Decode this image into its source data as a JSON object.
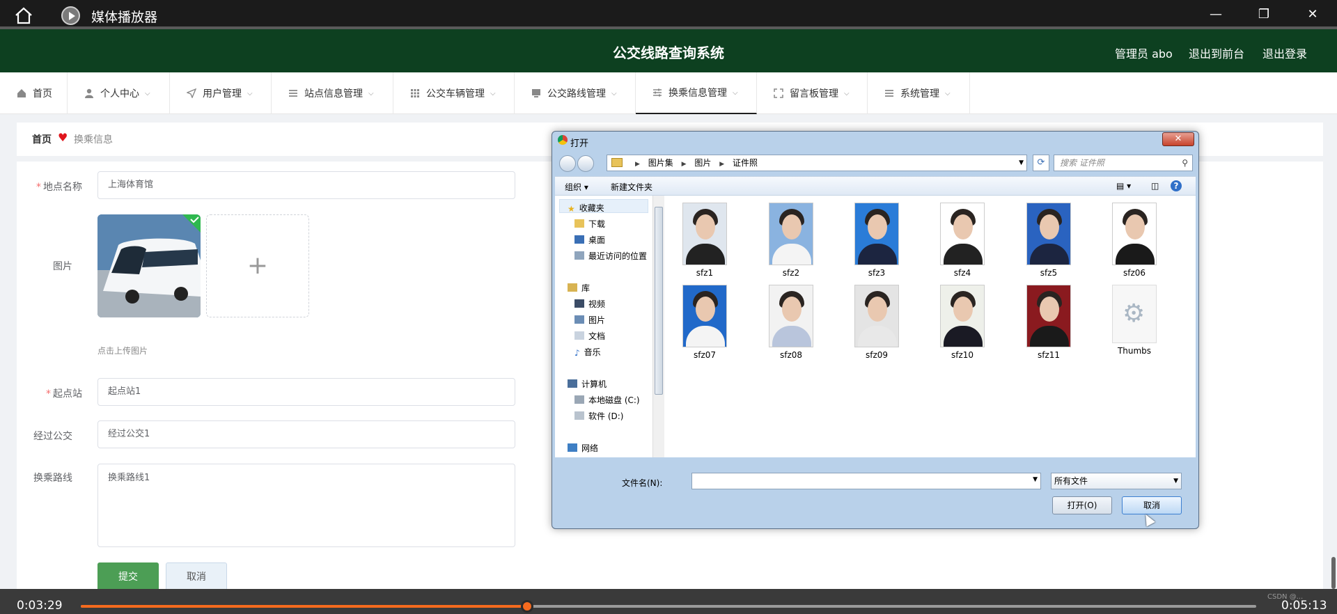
{
  "player": {
    "app_title": "媒体播放器",
    "current_time": "0:03:29",
    "total_time": "0:05:13",
    "progress_fraction": 0.38,
    "watermark": "CSDN @...",
    "accent": "#f56a1e"
  },
  "header": {
    "system_title": "公交线路查询系统",
    "admin_label": "管理员 abo",
    "frontend_link": "退出到前台",
    "logout_link": "退出登录",
    "bg_color": "#0d4020"
  },
  "nav": {
    "items": [
      {
        "label": "首页",
        "icon": "home-icon"
      },
      {
        "label": "个人中心",
        "icon": "user-icon"
      },
      {
        "label": "用户管理",
        "icon": "send-icon"
      },
      {
        "label": "站点信息管理",
        "icon": "list-icon"
      },
      {
        "label": "公交车辆管理",
        "icon": "grid-icon"
      },
      {
        "label": "公交路线管理",
        "icon": "monitor-icon"
      },
      {
        "label": "换乘信息管理",
        "icon": "sliders-icon"
      },
      {
        "label": "留言板管理",
        "icon": "expand-icon"
      },
      {
        "label": "系统管理",
        "icon": "menu-icon"
      }
    ],
    "active_index": 6
  },
  "breadcrumb": {
    "home": "首页",
    "current": "换乘信息"
  },
  "form": {
    "location_label": "地点名称",
    "location_value": "上海体育馆",
    "image_label": "图片",
    "upload_tip": "点击上传图片",
    "start_label": "起点站",
    "start_value": "起点站1",
    "bus_label": "经过公交",
    "bus_value": "经过公交1",
    "route_label": "换乘路线",
    "route_value": "换乘路线1",
    "submit_label": "提交",
    "cancel_label": "取消",
    "submit_color": "#4c9e55"
  },
  "dialog": {
    "title": "打开",
    "close_label": "✕",
    "path": [
      "图片集",
      "图片",
      "证件照"
    ],
    "search_placeholder": "搜索 证件照",
    "toolbar_organize": "组织 ▾",
    "toolbar_new_folder": "新建文件夹",
    "tree": [
      {
        "label": "收藏夹",
        "icon": "star-icon"
      },
      {
        "label": "下载",
        "icon": "download-folder-icon"
      },
      {
        "label": "桌面",
        "icon": "desktop-icon"
      },
      {
        "label": "最近访问的位置",
        "icon": "recent-icon"
      },
      {
        "label": "库",
        "icon": "library-icon"
      },
      {
        "label": "视频",
        "icon": "video-icon"
      },
      {
        "label": "图片",
        "icon": "pictures-icon"
      },
      {
        "label": "文档",
        "icon": "documents-icon"
      },
      {
        "label": "音乐",
        "icon": "music-icon"
      },
      {
        "label": "计算机",
        "icon": "computer-icon"
      },
      {
        "label": "本地磁盘 (C:)",
        "icon": "drive-c-icon"
      },
      {
        "label": "软件 (D:)",
        "icon": "drive-d-icon"
      },
      {
        "label": "网络",
        "icon": "network-icon"
      }
    ],
    "files": [
      {
        "name": "sfz1",
        "bg": "#dfe6ee",
        "body": "#222"
      },
      {
        "name": "sfz2",
        "bg": "#8ab3e0",
        "body": "#f4f4f4"
      },
      {
        "name": "sfz3",
        "bg": "#2a7cd8",
        "body": "#1c2540"
      },
      {
        "name": "sfz4",
        "bg": "#ffffff",
        "body": "#222"
      },
      {
        "name": "sfz5",
        "bg": "#2a63c0",
        "body": "#1c2540"
      },
      {
        "name": "sfz06",
        "bg": "#ffffff",
        "body": "#1a1a1a"
      },
      {
        "name": "sfz07",
        "bg": "#2169c9",
        "body": "#f4f4f4"
      },
      {
        "name": "sfz08",
        "bg": "#f2f2f2",
        "body": "#b9c5dc"
      },
      {
        "name": "sfz09",
        "bg": "#e4e4e4",
        "body": "#e8e8e8"
      },
      {
        "name": "sfz10",
        "bg": "#eef0ea",
        "body": "#1a1a24"
      },
      {
        "name": "sfz11",
        "bg": "#8a1a1f",
        "body": "#1a1a1a"
      },
      {
        "name": "Thumbs",
        "bg": "",
        "body": ""
      }
    ],
    "filename_label": "文件名(N):",
    "filename_value": "",
    "filetype_value": "所有文件",
    "open_label": "打开(O)",
    "cancel_label": "取消"
  }
}
